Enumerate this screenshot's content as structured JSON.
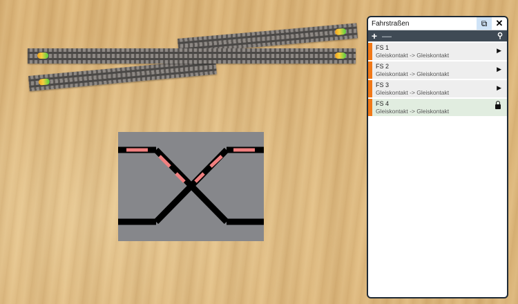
{
  "panel": {
    "title": "Fahrstraßen",
    "add_label": "+",
    "remove_label": "—",
    "popout_icon": "popout-icon",
    "close_icon": "close-icon",
    "search_icon": "search-icon",
    "routes": [
      {
        "name": "FS 1",
        "description": "Gleiskontakt -> Gleiskontakt",
        "state": "play"
      },
      {
        "name": "FS 2",
        "description": "Gleiskontakt -> Gleiskontakt",
        "state": "play"
      },
      {
        "name": "FS 3",
        "description": "Gleiskontakt -> Gleiskontakt",
        "state": "play"
      },
      {
        "name": "FS 4",
        "description": "Gleiskontakt -> Gleiskontakt",
        "state": "locked"
      }
    ]
  },
  "colors": {
    "route_accent": "#f07818",
    "locked_row": "#e1ede0",
    "board_bg": "#86878b",
    "track_active": "#f08080"
  }
}
